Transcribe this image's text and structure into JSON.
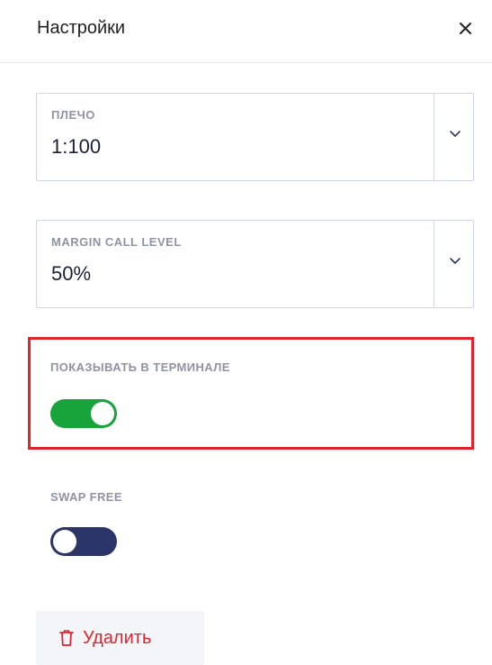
{
  "header": {
    "title": "Настройки",
    "close_icon": "close-icon"
  },
  "leverage": {
    "label": "ПЛЕЧО",
    "value": "1:100",
    "icon": "chevron-down-icon"
  },
  "margin_call": {
    "label": "MARGIN CALL LEVEL",
    "value": "50%",
    "icon": "chevron-down-icon"
  },
  "show_in_terminal": {
    "label": "ПОКАЗЫВАТЬ В ТЕРМИНАЛЕ",
    "enabled": true,
    "highlight_color": "#e0242c",
    "on_color": "#19a43b"
  },
  "swap_free": {
    "label": "SWAP FREE",
    "enabled": false,
    "off_color": "#2c3568"
  },
  "delete": {
    "label": "Удалить",
    "icon": "trash-icon",
    "color": "#e0242c"
  }
}
